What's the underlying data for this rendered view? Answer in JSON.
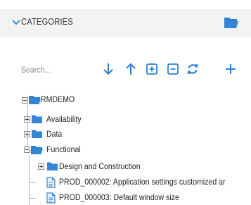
{
  "header": {
    "title": "CATEGORIES",
    "collapse_icon": "chevron-down-icon",
    "action_icon": "open-folder-icon"
  },
  "search": {
    "placeholder": "Search..."
  },
  "toolbar": {
    "tools": [
      "arrow-down-icon",
      "arrow-up-icon",
      "expand-all-icon",
      "collapse-all-icon",
      "refresh-icon",
      "add-icon"
    ]
  },
  "tree": {
    "root": {
      "label": "RMDEMO"
    },
    "items": [
      {
        "label": "Availability"
      },
      {
        "label": "Data"
      },
      {
        "label": "Functional"
      },
      {
        "label": "Design and Construction"
      },
      {
        "label": "PROD_000002: Application settings customized ar"
      },
      {
        "label": "PROD_000003: Default window size"
      }
    ]
  },
  "colors": {
    "accent": "#2e7fd4",
    "folder": "#3585d6",
    "header_bg": "#f3f3f3",
    "tree_line": "#b5b5b5"
  }
}
